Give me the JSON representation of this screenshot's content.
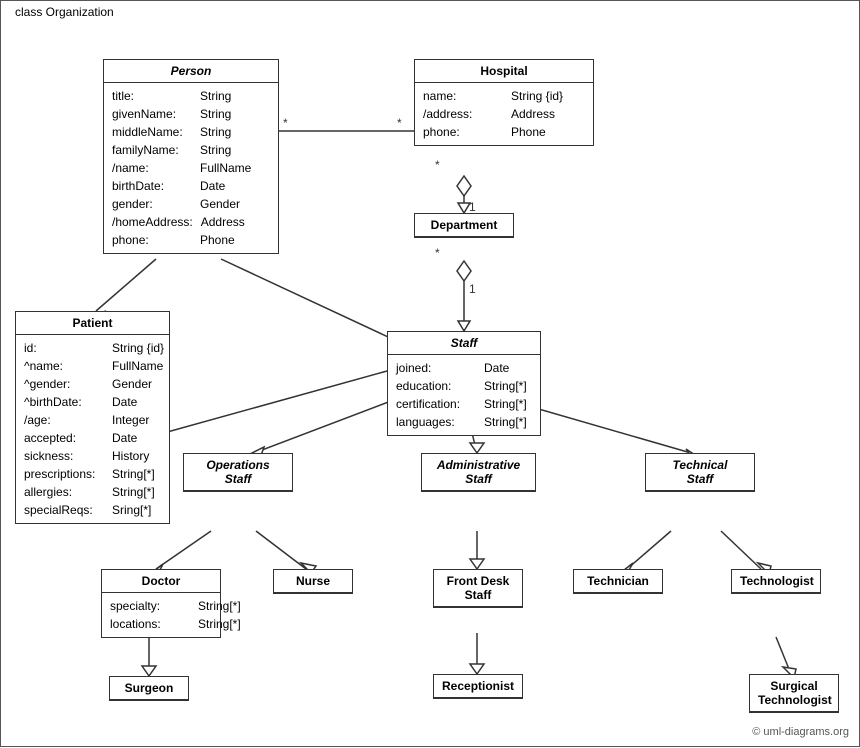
{
  "diagram": {
    "title": "class Organization",
    "copyright": "© uml-diagrams.org",
    "classes": {
      "person": {
        "name": "Person",
        "italic": true,
        "attributes": [
          {
            "name": "title:",
            "type": "String"
          },
          {
            "name": "givenName:",
            "type": "String"
          },
          {
            "name": "middleName:",
            "type": "String"
          },
          {
            "name": "familyName:",
            "type": "String"
          },
          {
            "name": "/name:",
            "type": "FullName"
          },
          {
            "name": "birthDate:",
            "type": "Date"
          },
          {
            "name": "gender:",
            "type": "Gender"
          },
          {
            "name": "/homeAddress:",
            "type": "Address"
          },
          {
            "name": "phone:",
            "type": "Phone"
          }
        ]
      },
      "hospital": {
        "name": "Hospital",
        "italic": false,
        "attributes": [
          {
            "name": "name:",
            "type": "String {id}"
          },
          {
            "name": "/address:",
            "type": "Address"
          },
          {
            "name": "phone:",
            "type": "Phone"
          }
        ]
      },
      "department": {
        "name": "Department",
        "italic": false,
        "attributes": []
      },
      "staff": {
        "name": "Staff",
        "italic": true,
        "attributes": [
          {
            "name": "joined:",
            "type": "Date"
          },
          {
            "name": "education:",
            "type": "String[*]"
          },
          {
            "name": "certification:",
            "type": "String[*]"
          },
          {
            "name": "languages:",
            "type": "String[*]"
          }
        ]
      },
      "patient": {
        "name": "Patient",
        "italic": false,
        "attributes": [
          {
            "name": "id:",
            "type": "String {id}"
          },
          {
            "name": "^name:",
            "type": "FullName"
          },
          {
            "name": "^gender:",
            "type": "Gender"
          },
          {
            "name": "^birthDate:",
            "type": "Date"
          },
          {
            "name": "/age:",
            "type": "Integer"
          },
          {
            "name": "accepted:",
            "type": "Date"
          },
          {
            "name": "sickness:",
            "type": "History"
          },
          {
            "name": "prescriptions:",
            "type": "String[*]"
          },
          {
            "name": "allergies:",
            "type": "String[*]"
          },
          {
            "name": "specialReqs:",
            "type": "Sring[*]"
          }
        ]
      },
      "operationsStaff": {
        "name": "Operations Staff",
        "italic": true
      },
      "administrativeStaff": {
        "name": "Administrative Staff",
        "italic": true
      },
      "technicalStaff": {
        "name": "Technical Staff",
        "italic": true
      },
      "doctor": {
        "name": "Doctor",
        "italic": false,
        "attributes": [
          {
            "name": "specialty:",
            "type": "String[*]"
          },
          {
            "name": "locations:",
            "type": "String[*]"
          }
        ]
      },
      "nurse": {
        "name": "Nurse",
        "italic": false
      },
      "frontDeskStaff": {
        "name": "Front Desk Staff",
        "italic": false
      },
      "technician": {
        "name": "Technician",
        "italic": false
      },
      "technologist": {
        "name": "Technologist",
        "italic": false
      },
      "surgeon": {
        "name": "Surgeon",
        "italic": false
      },
      "receptionist": {
        "name": "Receptionist",
        "italic": false
      },
      "surgicalTechnologist": {
        "name": "Surgical Technologist",
        "italic": false
      }
    }
  }
}
